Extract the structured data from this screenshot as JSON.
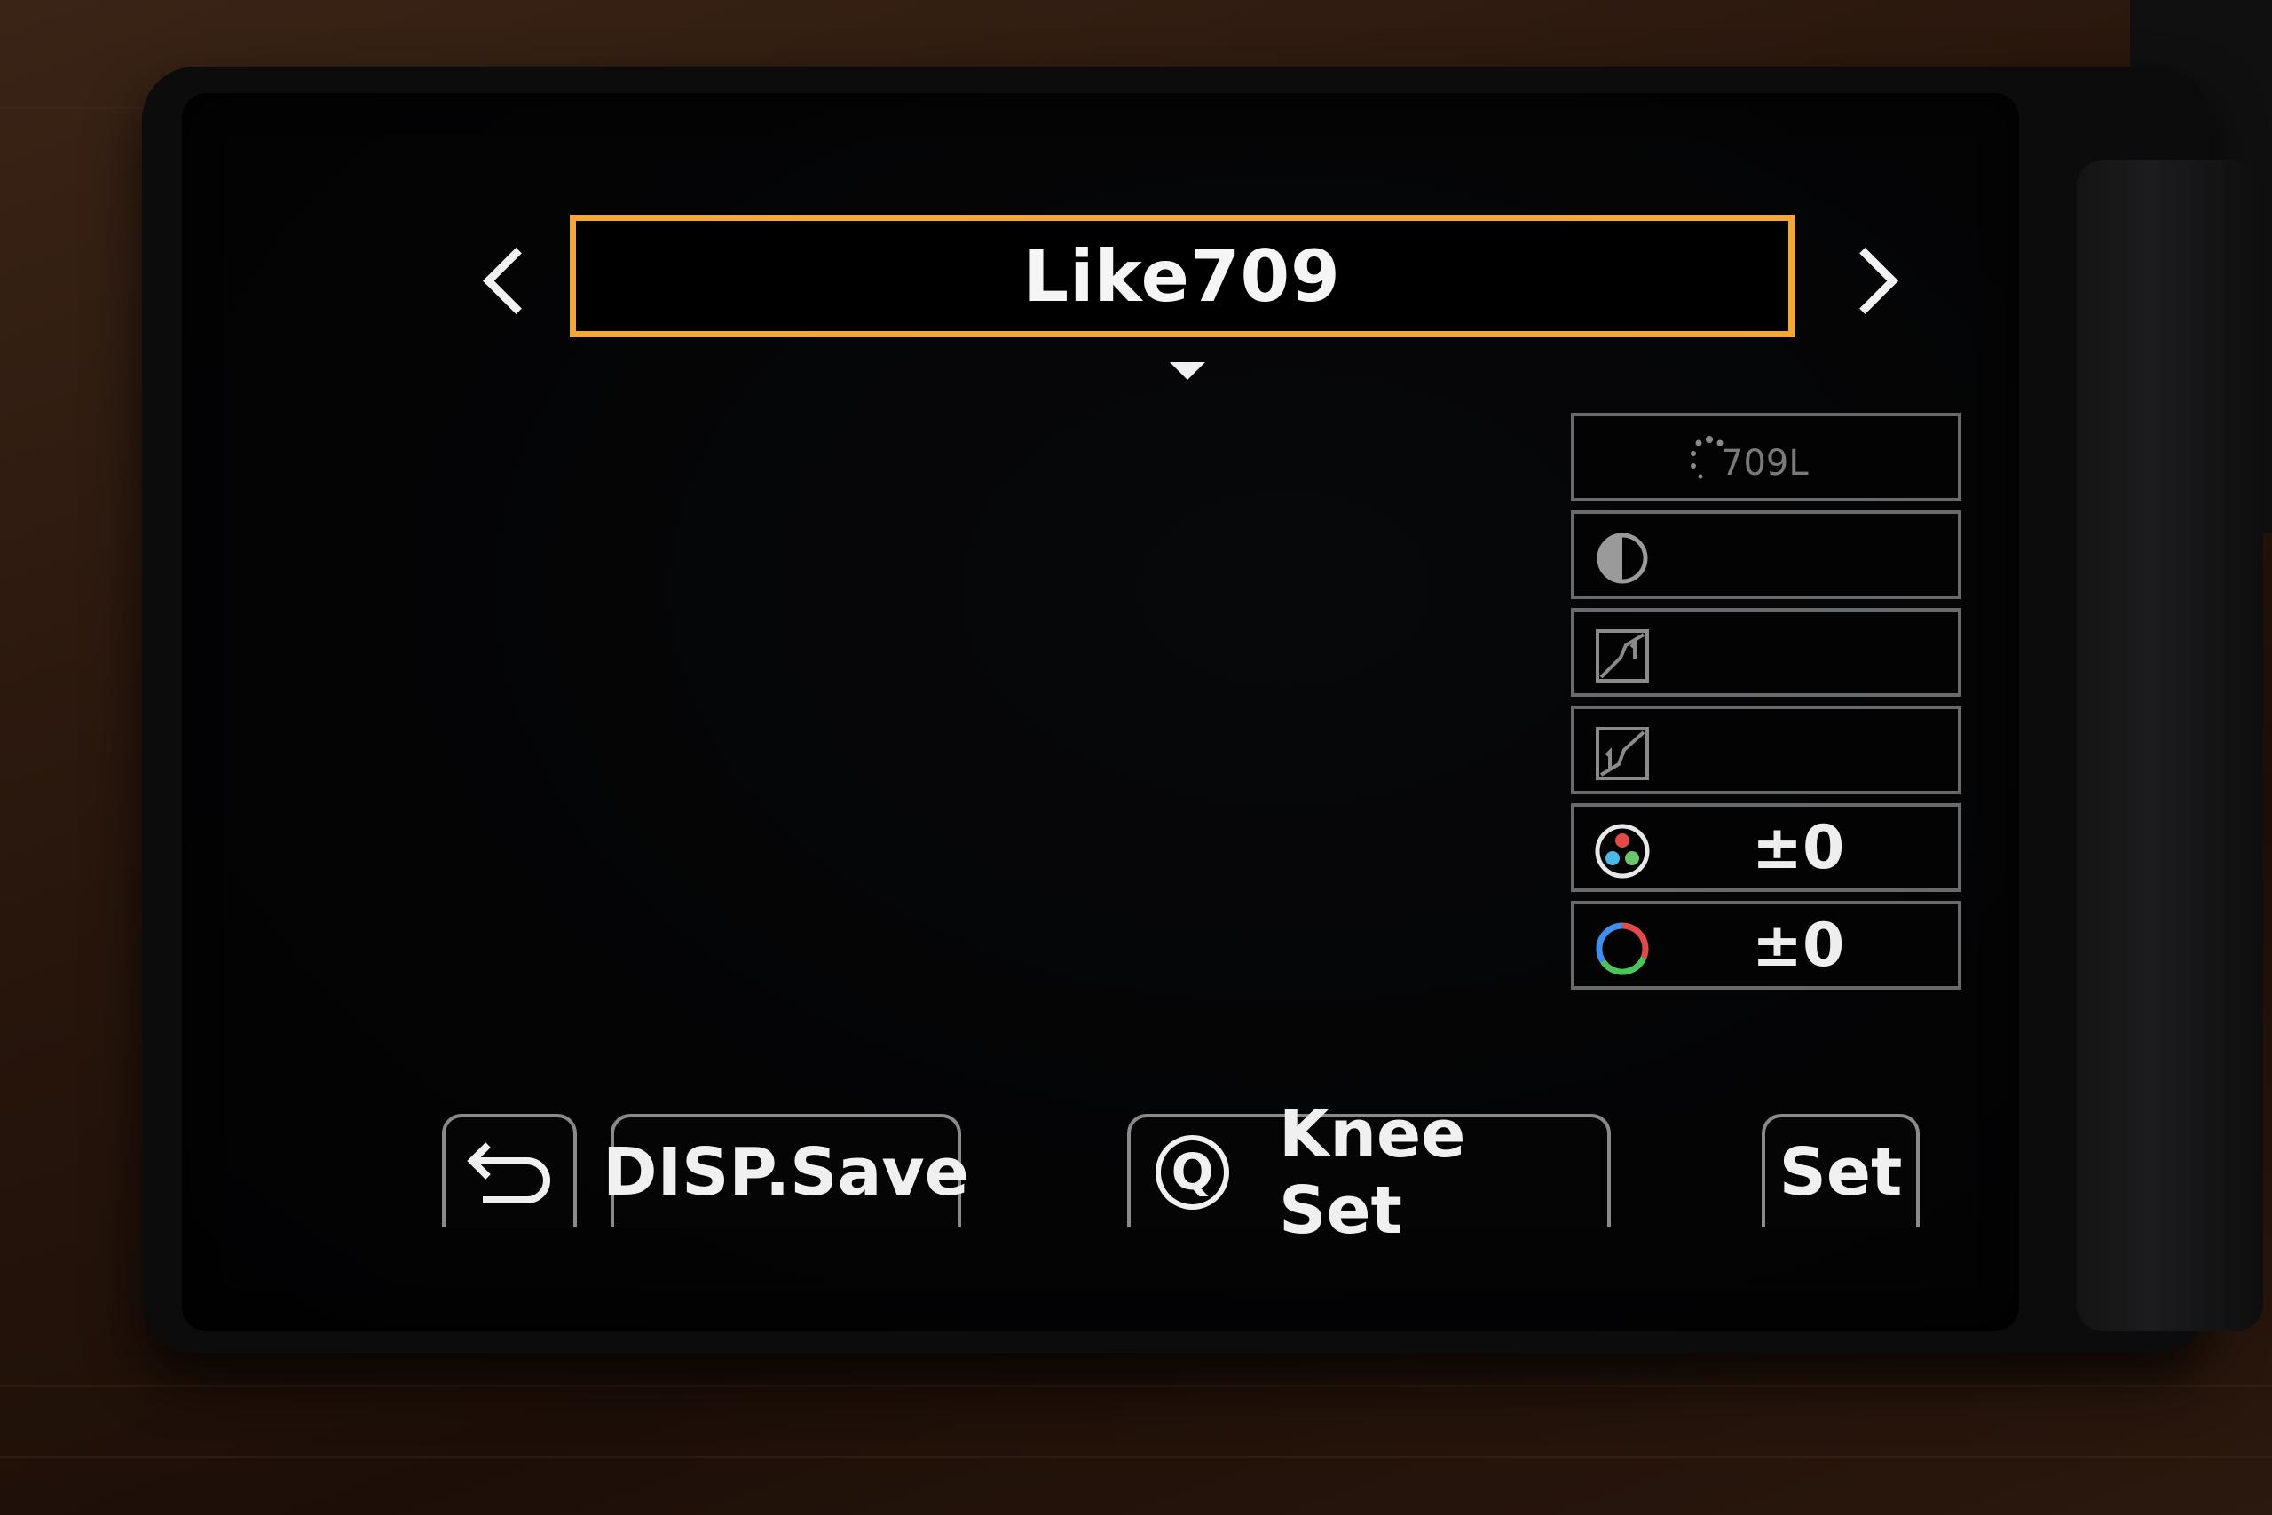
{
  "header": {
    "title": "Like709",
    "prev_icon": "chevron-left-icon",
    "next_icon": "chevron-right-icon"
  },
  "params": [
    {
      "name": "photo-style-709l",
      "icon": "photo-style-icon",
      "sub": "709L",
      "value": ""
    },
    {
      "name": "contrast",
      "icon": "contrast-icon",
      "value": ""
    },
    {
      "name": "highlight",
      "icon": "highlight-curve-icon",
      "value": ""
    },
    {
      "name": "shadow",
      "icon": "shadow-curve-icon",
      "value": ""
    },
    {
      "name": "saturation",
      "icon": "saturation-icon",
      "value": "±0"
    },
    {
      "name": "hue",
      "icon": "hue-icon",
      "value": "±0"
    }
  ],
  "softkeys": {
    "back_icon": "return-icon",
    "disp_label": "DISP.Save",
    "q_label": "Q",
    "knee_label": "Knee Set",
    "set_label": "Set"
  },
  "colors": {
    "selection_border": "#f3a735",
    "screen_bg": "#040405"
  }
}
